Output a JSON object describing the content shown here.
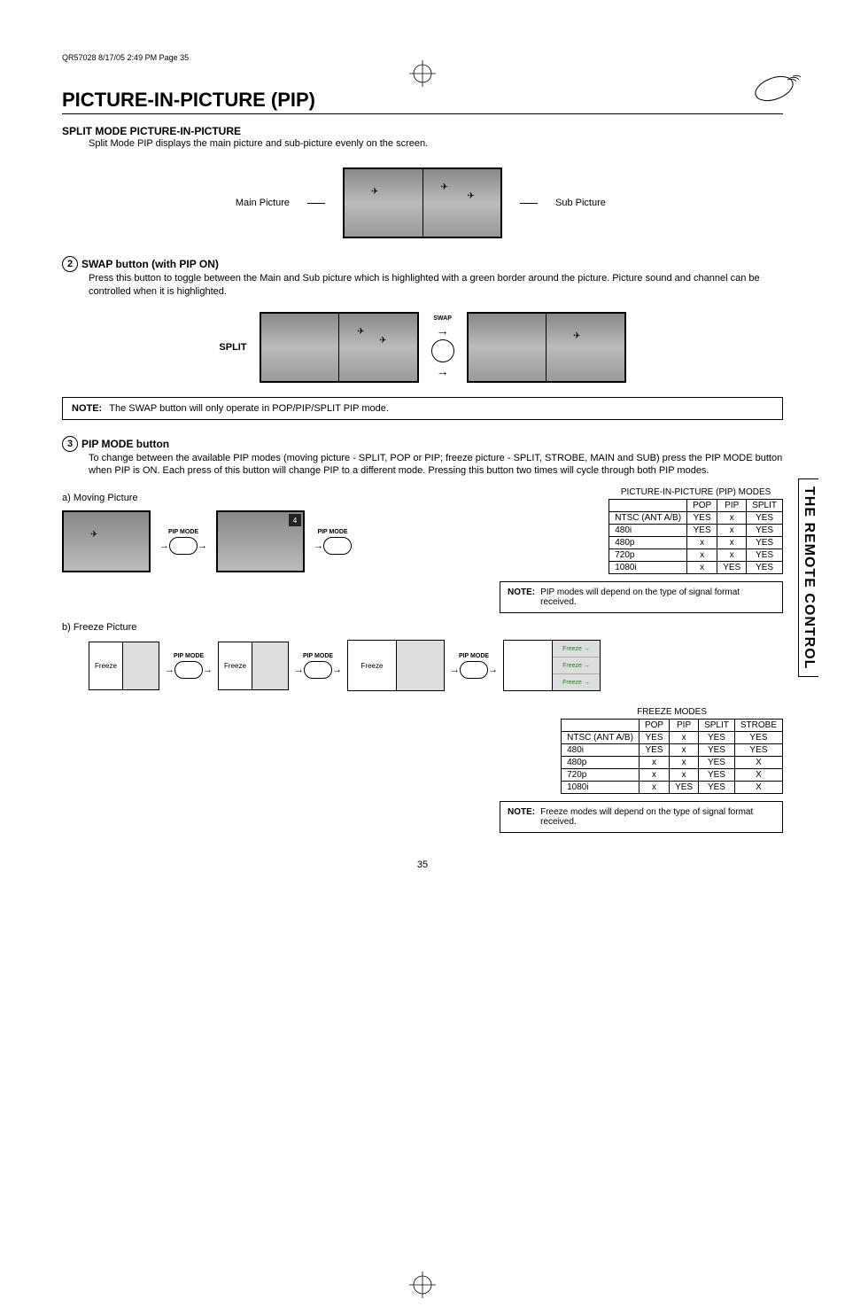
{
  "header_stamp": "QR57028  8/17/05  2:49 PM  Page 35",
  "page_title": "PICTURE-IN-PICTURE (PIP)",
  "side_tab": "THE REMOTE CONTROL",
  "page_number": "35",
  "split_mode": {
    "heading": "SPLIT MODE PICTURE-IN-PICTURE",
    "desc": "Split Mode PIP displays the main picture and sub-picture evenly on the screen.",
    "main_label": "Main Picture",
    "sub_label": "Sub Picture"
  },
  "swap": {
    "number": "2",
    "heading": "SWAP button (with PIP ON)",
    "desc": "Press this button to toggle between the Main and Sub picture which is highlighted with a green border around the picture.  Picture sound and channel can be controlled when it is highlighted.",
    "split_label": "SPLIT",
    "swap_label": "SWAP"
  },
  "note_swap": {
    "label": "NOTE:",
    "text": "The SWAP button will only operate in POP/PIP/SPLIT PIP mode."
  },
  "pipmode": {
    "number": "3",
    "heading": "PIP MODE button",
    "desc": "To change between the available PIP modes (moving picture - SPLIT, POP or PIP; freeze picture - SPLIT, STROBE, MAIN and SUB) press the PIP MODE button when PIP is ON.  Each press of this button will change PIP to a different mode.  Pressing this button two times will cycle through both PIP modes.",
    "a_label": "a) Moving Picture",
    "b_label": "b) Freeze Picture",
    "pipmode_btn": "PIP MODE",
    "corner_num": "4"
  },
  "note_pip": {
    "label": "NOTE:",
    "text": "PIP modes will depend on the type of signal format received."
  },
  "note_freeze": {
    "label": "NOTE:",
    "text": "Freeze modes will depend on the type of signal format received."
  },
  "pip_table": {
    "caption": "PICTURE-IN-PICTURE (PIP) MODES",
    "headers": [
      "",
      "POP",
      "PIP",
      "SPLIT"
    ],
    "rows": [
      [
        "NTSC (ANT A/B)",
        "YES",
        "x",
        "YES"
      ],
      [
        "480i",
        "YES",
        "x",
        "YES"
      ],
      [
        "480p",
        "x",
        "x",
        "YES"
      ],
      [
        "720p",
        "x",
        "x",
        "YES"
      ],
      [
        "1080i",
        "x",
        "YES",
        "YES"
      ]
    ]
  },
  "freeze_table": {
    "caption": "FREEZE MODES",
    "headers": [
      "",
      "POP",
      "PIP",
      "SPLIT",
      "STROBE"
    ],
    "rows": [
      [
        "NTSC (ANT A/B)",
        "YES",
        "x",
        "YES",
        "YES"
      ],
      [
        "480i",
        "YES",
        "x",
        "YES",
        "YES"
      ],
      [
        "480p",
        "x",
        "x",
        "YES",
        "X"
      ],
      [
        "720p",
        "x",
        "x",
        "YES",
        "X"
      ],
      [
        "1080i",
        "x",
        "YES",
        "YES",
        "X"
      ]
    ]
  },
  "freeze_labels": {
    "freeze": "Freeze",
    "freeze_arrow": "Freeze →"
  }
}
